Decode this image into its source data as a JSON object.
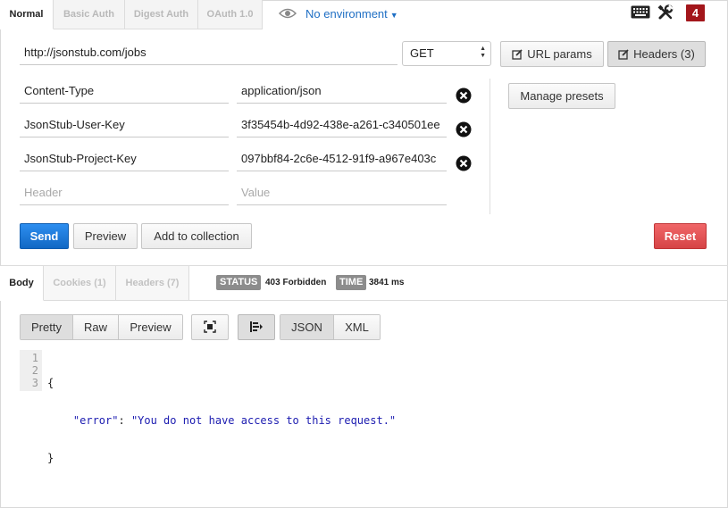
{
  "auth_tabs": [
    "Normal",
    "Basic Auth",
    "Digest Auth",
    "OAuth 1.0"
  ],
  "environment": {
    "label": "No environment",
    "icon": "eye-icon"
  },
  "toolbar_icons": [
    "keyboard-icon",
    "wrench-icon"
  ],
  "notification_count": "4",
  "request": {
    "url": "http://jsonstub.com/jobs",
    "method": "GET",
    "url_params_label": "URL params",
    "headers_label": "Headers (3)"
  },
  "headers": [
    {
      "key": "Content-Type",
      "value": "application/json"
    },
    {
      "key": "JsonStub-User-Key",
      "value": "3f35454b-4d92-438e-a261-c340501ee"
    },
    {
      "key": "JsonStub-Project-Key",
      "value": "097bbf84-2c6e-4512-91f9-a967e403c"
    }
  ],
  "header_placeholders": {
    "key": "Header",
    "value": "Value"
  },
  "manage_presets_label": "Manage presets",
  "actions": {
    "send": "Send",
    "preview": "Preview",
    "add_to_collection": "Add to collection",
    "reset": "Reset"
  },
  "response_tabs": [
    "Body",
    "Cookies (1)",
    "Headers (7)"
  ],
  "status": {
    "label": "STATUS",
    "value": "403 Forbidden"
  },
  "time": {
    "label": "TIME",
    "value": "3841 ms"
  },
  "view_modes": [
    "Pretty",
    "Raw",
    "Preview"
  ],
  "formats": [
    "JSON",
    "XML"
  ],
  "code": {
    "line_numbers": [
      "1",
      "2",
      "3"
    ],
    "open": "{",
    "key": "\"error\"",
    "colon": ": ",
    "value": "\"You do not have access to this request.\"",
    "close": "}"
  },
  "colors": {
    "primary": "#1168c4",
    "danger": "#d64446",
    "badge": "#a3161b",
    "link": "#1f6fc4"
  }
}
